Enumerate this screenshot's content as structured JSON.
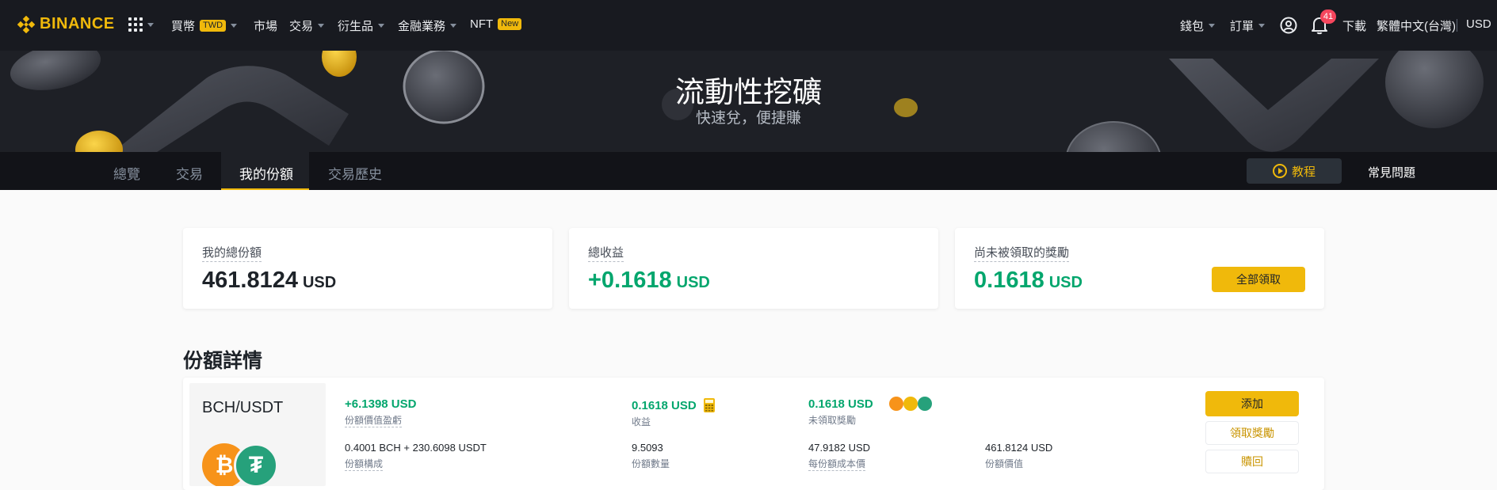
{
  "nav": {
    "brand": "BINANCE",
    "buy_crypto": "買幣",
    "buy_crypto_tag": "TWD",
    "markets": "市場",
    "trade": "交易",
    "derivatives": "衍生品",
    "finance": "金融業務",
    "nft": "NFT",
    "nft_tag": "New",
    "wallet": "錢包",
    "orders": "訂單",
    "notifications_count": "41",
    "download": "下載",
    "language": "繁體中文(台灣)",
    "currency": "USD"
  },
  "hero": {
    "title": "流動性挖礦",
    "subtitle": "快速兌，便捷賺"
  },
  "tabs": [
    {
      "label": "總覽"
    },
    {
      "label": "交易"
    },
    {
      "label": "我的份額"
    },
    {
      "label": "交易歷史"
    }
  ],
  "tutorial_label": "教程",
  "faq_label": "常見問題",
  "summary": {
    "total_share": {
      "label": "我的總份額",
      "value": "461.8124",
      "unit": "USD"
    },
    "total_earnings": {
      "label": "總收益",
      "value": "+0.1618",
      "unit": "USD"
    },
    "unclaimed": {
      "label": "尚未被領取的獎勵",
      "value": "0.1618",
      "unit": "USD",
      "button": "全部領取"
    }
  },
  "section_title": "份額詳情",
  "position": {
    "pair": "BCH/USDT",
    "value_pnl": "+6.1398 USD",
    "value_pnl_label": "份額價值盈虧",
    "earnings": "0.1618 USD",
    "earnings_label": "收益",
    "unclaimed": "0.1618 USD",
    "unclaimed_label": "未領取獎勵",
    "composition": "0.4001 BCH + 230.6098 USDT",
    "composition_label": "份額構成",
    "shares": "9.5093",
    "shares_label": "份額數量",
    "cost_per_share": "47.9182 USD",
    "cost_per_share_label": "每份額成本價",
    "share_value": "461.8124 USD",
    "share_value_label": "份額價值",
    "add_button": "添加",
    "claim_button": "領取獎勵",
    "redeem_button": "贖回"
  },
  "colors": {
    "brand": "#f0b90b",
    "positive": "#03a66d",
    "nav_bg": "#181a20"
  }
}
